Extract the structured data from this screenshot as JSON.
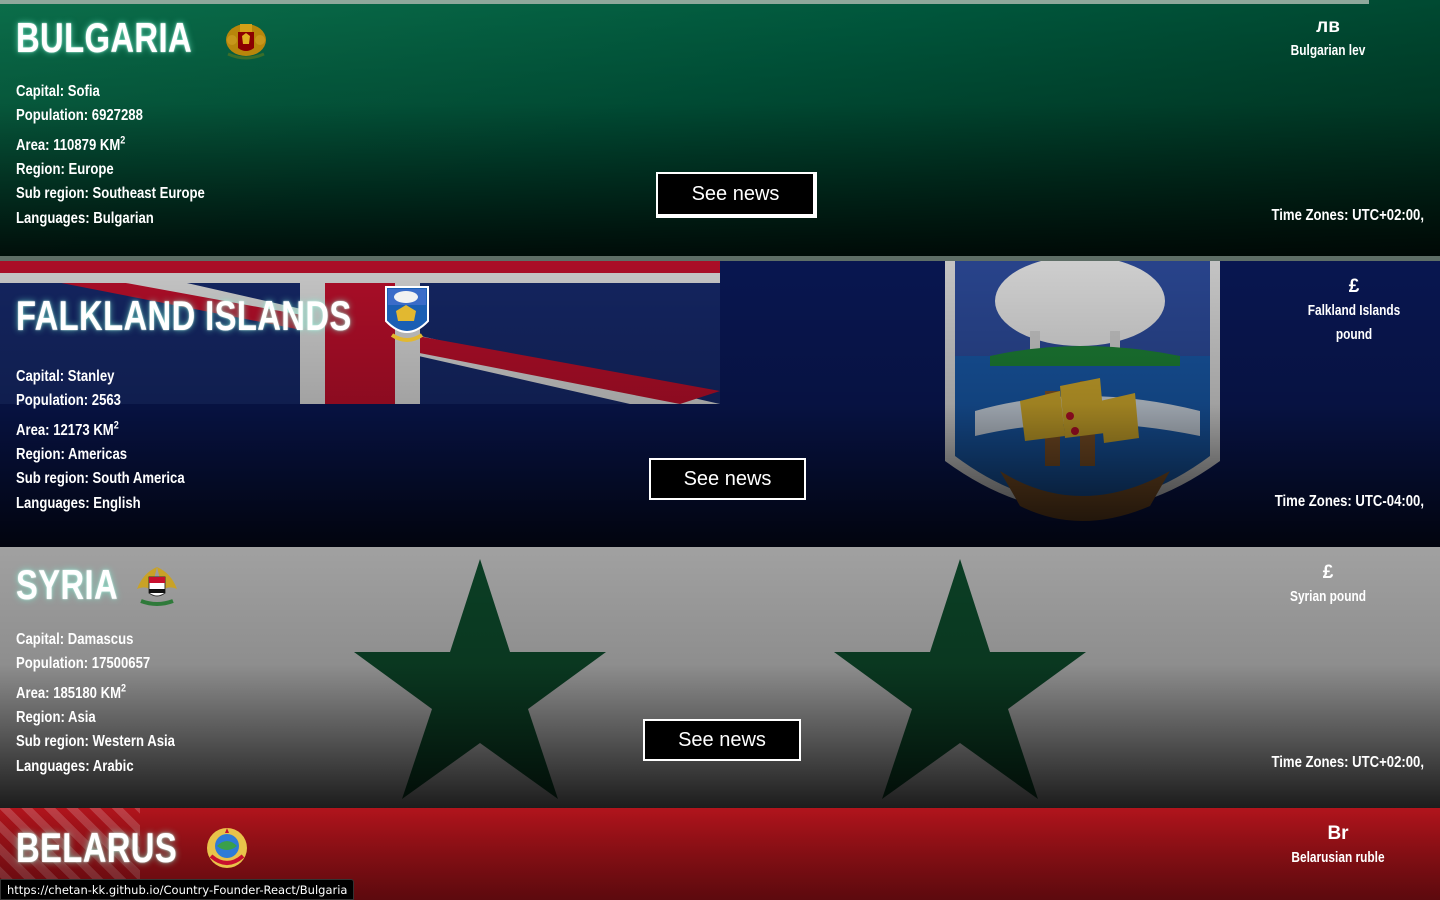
{
  "countries": [
    {
      "name": "BULGARIA",
      "capital": "Capital: Sofia",
      "population": "Population: 6927288",
      "area": "Area: 110879 KM",
      "area_unit_sup": "2",
      "region": "Region: Europe",
      "subregion": "Sub region: Southeast Europe",
      "languages": "Languages: Bulgarian",
      "currency_symbol": "лв",
      "currency_name": "Bulgarian lev",
      "currency_name_line2": "",
      "timezones": "Time Zones: UTC+02:00,",
      "news_label": "See news",
      "colors": {
        "bg_top": "#00966e",
        "bg_bottom": "#003d2a"
      }
    },
    {
      "name": "FALKLAND ISLANDS",
      "capital": "Capital: Stanley",
      "population": "Population: 2563",
      "area": "Area: 12173 KM",
      "area_unit_sup": "2",
      "region": "Region: Americas",
      "subregion": "Sub region: South America",
      "languages": "Languages: English",
      "currency_symbol": "£",
      "currency_name": "Falkland Islands",
      "currency_name_line2": "pound",
      "timezones": "Time Zones: UTC-04:00,",
      "news_label": "See news",
      "colors": {
        "bg": "#012169",
        "cross": "#c8102e"
      }
    },
    {
      "name": "SYRIA",
      "capital": "Capital: Damascus",
      "population": "Population: 17500657",
      "area": "Area: 185180 KM",
      "area_unit_sup": "2",
      "region": "Region: Asia",
      "subregion": "Sub region: Western Asia",
      "languages": "Languages: Arabic",
      "currency_symbol": "£",
      "currency_name": "Syrian pound",
      "currency_name_line2": "",
      "timezones": "Time Zones: UTC+02:00,",
      "news_label": "See news",
      "colors": {
        "bg": "#b9b9b9",
        "star": "#0c4a2a"
      }
    },
    {
      "name": "BELARUS",
      "currency_symbol": "Br",
      "currency_name": "Belarusian ruble",
      "colors": {
        "bg": "#b3141c"
      }
    }
  ],
  "status_bar": {
    "url": "https://chetan-kk.github.io/Country-Founder-React/Bulgaria"
  },
  "icons": [
    "bulgaria-coat-of-arms-icon",
    "falkland-coat-of-arms-icon",
    "syria-coat-of-arms-icon",
    "belarus-coat-of-arms-icon"
  ]
}
